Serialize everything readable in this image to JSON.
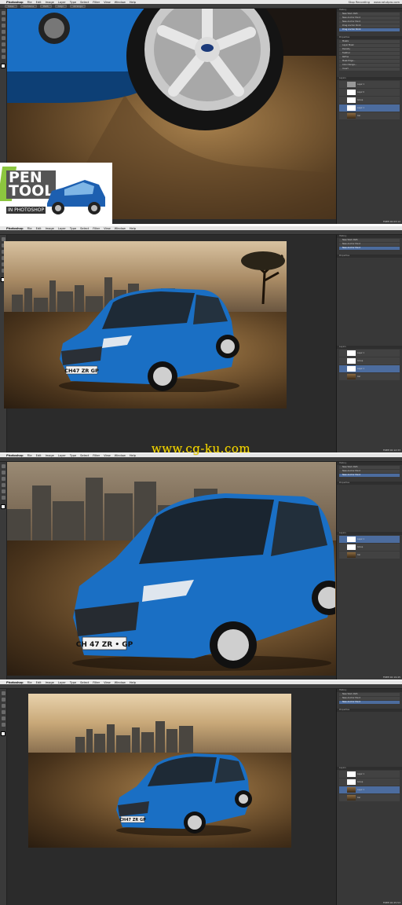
{
  "app": {
    "name": "Photoshop",
    "menu": [
      "File",
      "Edit",
      "Image",
      "Layer",
      "Type",
      "Select",
      "Filter",
      "View",
      "Window",
      "Help"
    ],
    "menubar_right": [
      "Stop Recording",
      "www.ratutpro.com"
    ]
  },
  "options_bar": {
    "items": [
      "Sizes",
      "Combine",
      "Path",
      "Align",
      "Arrange"
    ]
  },
  "panels": {
    "history_tab": "History",
    "adjust_tab": "Properties",
    "history_items": [
      "New Work Path",
      "New Anchor Point",
      "New Anchor Point",
      "Drag Anchor Point",
      "Drag Anchor Point"
    ],
    "properties_title": "Masks",
    "properties_rows": [
      "Layer Mask",
      "Density",
      "Feather",
      "Refine",
      "Mask Edge...",
      "Color Range...",
      "Invert"
    ],
    "layers_tab": "Layers",
    "layers": [
      "Layer 1",
      "Layer 0",
      "Group",
      "Layer 1",
      "Car"
    ]
  },
  "frames": [
    {
      "status": "FREE",
      "time": "00:03:12"
    },
    {
      "status": "FREE",
      "time": "00:12:33"
    },
    {
      "status": "FREE",
      "time": "00:19:45"
    },
    {
      "status": "FREE",
      "time": "00:25:53"
    }
  ],
  "car": {
    "plate": "CH 47 ZR • GP",
    "plate_short": "CH47 ZR GP",
    "brand": "Ford",
    "color": "#1a6fc4"
  },
  "logo": {
    "title_line1": "PEN",
    "title_line2": "TOOL",
    "subtitle": "IN PHOTOSHOP"
  },
  "watermark": "www.cg-ku.com",
  "colors": {
    "chrome": "#2b2b2b",
    "panel": "#383838",
    "selection": "#4c6c9e",
    "accent_watermark": "#f5d800"
  }
}
